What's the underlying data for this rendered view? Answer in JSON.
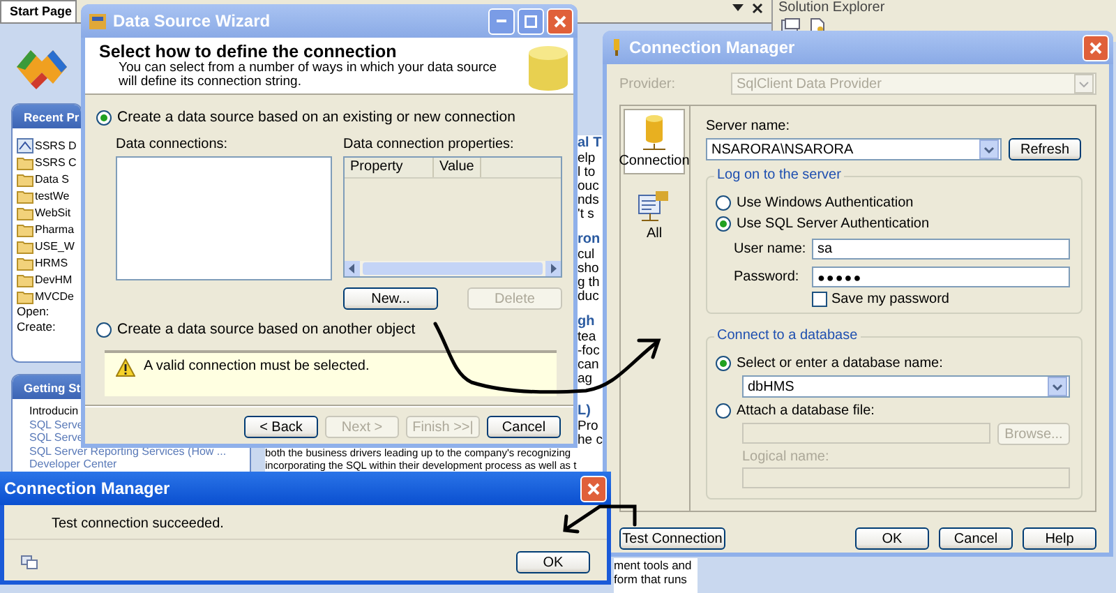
{
  "background": {
    "tab": "Start Page",
    "recent_projects": {
      "title": "Recent Pr",
      "items": [
        {
          "name": "SSRS D",
          "kind": "solution"
        },
        {
          "name": "SSRS C",
          "kind": "folder"
        },
        {
          "name": "Data S",
          "kind": "folder"
        },
        {
          "name": "testWe",
          "kind": "folder"
        },
        {
          "name": "WebSit",
          "kind": "folder"
        },
        {
          "name": "Pharma",
          "kind": "folder"
        },
        {
          "name": "USE_W",
          "kind": "folder"
        },
        {
          "name": "HRMS",
          "kind": "folder"
        },
        {
          "name": "DevHM",
          "kind": "folder"
        },
        {
          "name": "MVCDe",
          "kind": "folder"
        }
      ],
      "open_label": "Open:",
      "create_label": "Create:"
    },
    "getting_started": {
      "title": "Getting St",
      "items": [
        {
          "text": "Introducin",
          "kind": "plain"
        },
        {
          "text": "SQL Serve",
          "kind": "link"
        },
        {
          "text": "SQL Serve",
          "kind": "link"
        },
        {
          "text": "SQL Server Reporting Services (How ...",
          "kind": "link"
        },
        {
          "text": "Developer Center",
          "kind": "link"
        }
      ]
    },
    "article_fragments": [
      {
        "heading": "al T",
        "lines": [
          "elp",
          "l to",
          "ouc",
          "nds",
          "'t s"
        ]
      },
      {
        "heading": "ron",
        "lines": [
          "cul",
          "sho",
          "g th",
          "duc"
        ]
      },
      {
        "heading": "gh",
        "lines": [
          "tea",
          "-foc",
          "can",
          "ag"
        ]
      },
      {
        "heading": "L)",
        "lines": [
          "Pro",
          "he c"
        ]
      }
    ],
    "article_lines": [
      "both the business drivers leading up to the company's recognizing",
      "incorporating the SQL within their development process as well as t"
    ],
    "article_tail": [
      "ment tools and",
      "form that runs"
    ],
    "solution_explorer": {
      "title": "Solution Explorer"
    }
  },
  "wizard": {
    "title": "Data Source Wizard",
    "heading": "Select how to define the connection",
    "subtitle": "You can select from a number of ways in which your data source will define its connection string.",
    "options": [
      {
        "label": "Create a data source based on an existing or new connection",
        "selected": true
      },
      {
        "label": "Create a data source based on another object",
        "selected": false
      }
    ],
    "connections_label": "Data connections:",
    "properties_label": "Data connection properties:",
    "property_columns": [
      "Property",
      "Value"
    ],
    "list_buttons": [
      {
        "label": "New...",
        "disabled": false
      },
      {
        "label": "Delete",
        "disabled": true
      }
    ],
    "warning": "A valid connection must be selected.",
    "nav_buttons": [
      {
        "label": "< Back",
        "disabled": false
      },
      {
        "label": "Next >",
        "disabled": true
      },
      {
        "label": "Finish >>|",
        "disabled": true
      },
      {
        "label": "Cancel",
        "disabled": false
      }
    ]
  },
  "connection_manager": {
    "title": "Connection Manager",
    "provider_label": "Provider:",
    "provider": "SqlClient Data Provider",
    "pages": [
      {
        "label": "Connection",
        "selected": true
      },
      {
        "label": "All",
        "selected": false
      }
    ],
    "server_label": "Server name:",
    "server": "NSARORA\\NSARORA",
    "refresh": "Refresh",
    "logon": {
      "title": "Log on to the server",
      "modes": [
        {
          "label": "Use Windows Authentication",
          "selected": false
        },
        {
          "label": "Use SQL Server Authentication",
          "selected": true
        }
      ],
      "user_label": "User name:",
      "user": "sa",
      "password_label": "Password:",
      "password": "●●●●●",
      "save_password": {
        "label": "Save my password",
        "checked": false
      }
    },
    "database": {
      "title": "Connect to a database",
      "modes": [
        {
          "label": "Select or enter a database name:",
          "selected": true
        },
        {
          "label": "Attach a database file:",
          "selected": false
        }
      ],
      "database_name": "dbHMS",
      "browse": "Browse...",
      "logical_name_label": "Logical name:"
    },
    "buttons": [
      {
        "label": "Test Connection",
        "kind": "left"
      },
      {
        "label": "OK",
        "kind": "right"
      },
      {
        "label": "Cancel",
        "kind": "right"
      },
      {
        "label": "Help",
        "kind": "right"
      }
    ]
  },
  "message_box": {
    "title": "Connection Manager",
    "message": "Test connection succeeded.",
    "ok": "OK"
  }
}
